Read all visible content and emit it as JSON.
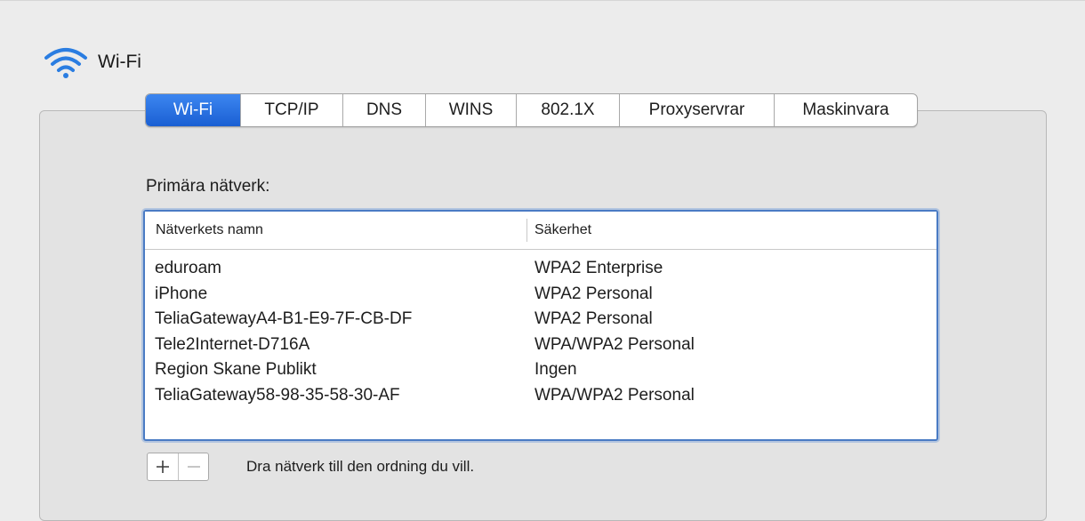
{
  "header": {
    "title": "Wi-Fi",
    "icon": "wifi-icon",
    "accent_color": "#2a7de1"
  },
  "tabs": [
    {
      "label": "Wi-Fi",
      "active": true
    },
    {
      "label": "TCP/IP",
      "active": false
    },
    {
      "label": "DNS",
      "active": false
    },
    {
      "label": "WINS",
      "active": false
    },
    {
      "label": "802.1X",
      "active": false
    },
    {
      "label": "Proxyservrar",
      "active": false
    },
    {
      "label": "Maskinvara",
      "active": false
    }
  ],
  "preferred_networks": {
    "label": "Primära nätverk:",
    "columns": [
      "Nätverkets namn",
      "Säkerhet"
    ],
    "rows": [
      {
        "name": "eduroam",
        "security": "WPA2 Enterprise"
      },
      {
        "name": "iPhone",
        "security": "WPA2 Personal"
      },
      {
        "name": "TeliaGatewayA4-B1-E9-7F-CB-DF",
        "security": "WPA2 Personal"
      },
      {
        "name": "Tele2Internet-D716A",
        "security": "WPA/WPA2 Personal"
      },
      {
        "name": "Region Skane Publikt",
        "security": "Ingen"
      },
      {
        "name": "TeliaGateway58-98-35-58-30-AF",
        "security": "WPA/WPA2 Personal"
      }
    ]
  },
  "controls": {
    "add_icon": "plus-icon",
    "remove_icon": "minus-icon",
    "hint": "Dra nätverk till den ordning du vill."
  }
}
